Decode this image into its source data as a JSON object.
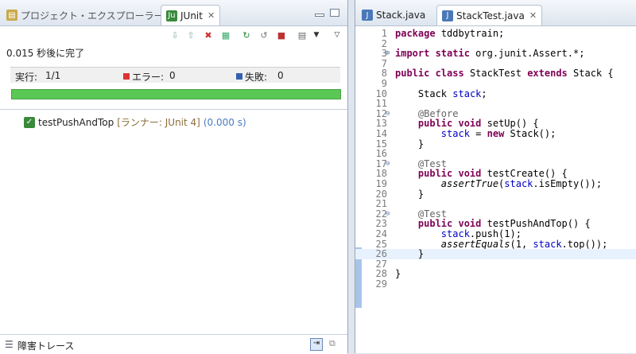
{
  "left_panel": {
    "tabs": [
      {
        "label": "プロジェクト・エクスプローラー"
      },
      {
        "label": "JUnit"
      }
    ],
    "status": "0.015 秒後に完了",
    "counters": {
      "runs_label": "実行:",
      "runs_value": "1/1",
      "errors_label": "エラー:",
      "errors_value": "0",
      "failures_label": "失敗:",
      "failures_value": "0"
    },
    "progress": 1.0,
    "test": {
      "name": "testPushAndTop",
      "runner": "[ランナー: JUnit 4]",
      "time": "(0.000 s)"
    },
    "bottom_label": "障害トレース"
  },
  "editor": {
    "tabs": [
      {
        "label": "Stack.java"
      },
      {
        "label": "StackTest.java"
      }
    ],
    "line_numbers": [
      "1",
      "2",
      "3",
      "7",
      "8",
      "9",
      "10",
      "11",
      "12",
      "13",
      "14",
      "15",
      "16",
      "17",
      "18",
      "19",
      "20",
      "21",
      "22",
      "23",
      "24",
      "25",
      "26",
      "27",
      "28",
      "29"
    ],
    "code": {
      "l1_kw": "package",
      "l1_rest": "tddbytrain;",
      "l3_kw": "import static",
      "l3_rest": "org.junit.Assert.*;",
      "l8_kw1": "public class",
      "l8_name": "StackTest",
      "l8_kw2": "extends",
      "l8_rest": "Stack {",
      "l10_type": "Stack",
      "l10_field": "stack",
      "l12": "@Before",
      "l13_kw": "public void",
      "l13_rest": "setUp() {",
      "l14_field": "stack",
      "l14_op": "=",
      "l14_kw": "new",
      "l14_rest": "Stack();",
      "l15": "}",
      "l17": "@Test",
      "l18_kw": "public void",
      "l18_rest": "testCreate() {",
      "l19_method": "assertTrue",
      "l19_field": "stack",
      "l19_rest": ".isEmpty());",
      "l20": "}",
      "l22": "@Test",
      "l23_kw": "public void",
      "l23_rest": "testPushAndTop() {",
      "l24_field": "stack",
      "l24_rest": ".push(1);",
      "l25_method": "assertEquals",
      "l25_mid": "(1,",
      "l25_field": "stack",
      "l25_rest": ".top());",
      "l26": "}",
      "l28": "}"
    }
  }
}
